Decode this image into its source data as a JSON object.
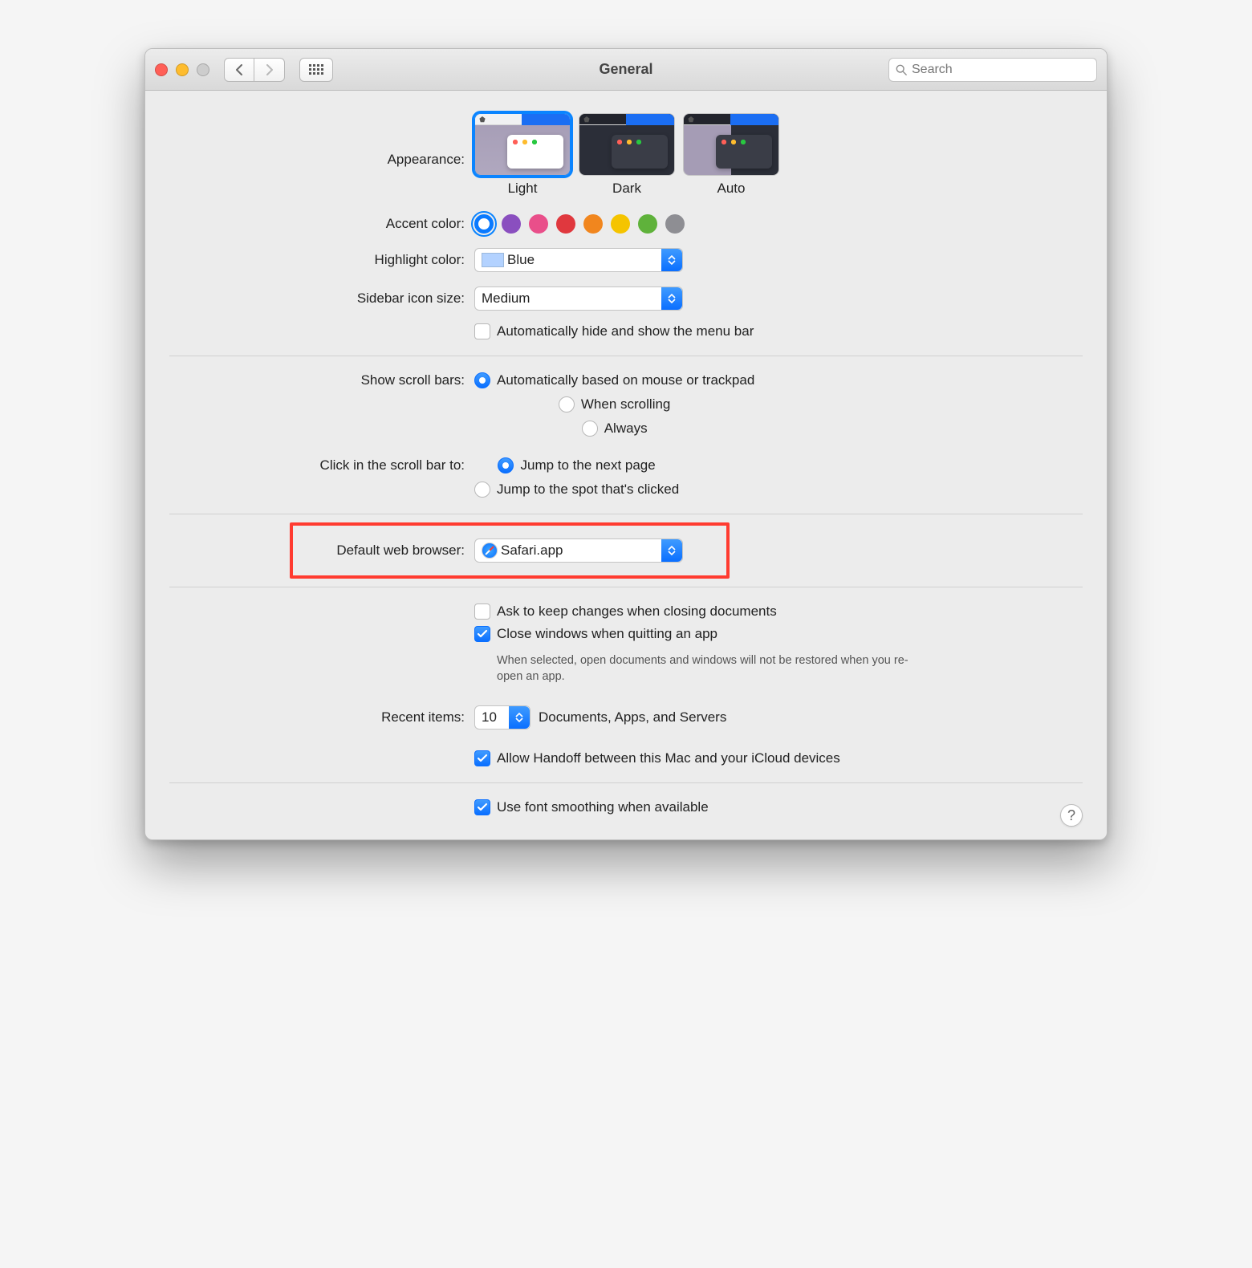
{
  "window": {
    "title": "General"
  },
  "toolbar": {
    "search_placeholder": "Search"
  },
  "appearance": {
    "label": "Appearance:",
    "options": [
      "Light",
      "Dark",
      "Auto"
    ],
    "selected": "Light"
  },
  "accent": {
    "label": "Accent color:",
    "colors": [
      "#0a7aff",
      "#8a4fbf",
      "#e94f8a",
      "#e0383e",
      "#f1861e",
      "#f5c400",
      "#5fb23b",
      "#8e8e93"
    ],
    "selected_index": 0
  },
  "highlight": {
    "label": "Highlight color:",
    "value": "Blue"
  },
  "sidebar": {
    "label": "Sidebar icon size:",
    "value": "Medium"
  },
  "menubar_autohide": {
    "label": "Automatically hide and show the menu bar",
    "checked": false
  },
  "scrollbars": {
    "label": "Show scroll bars:",
    "options": [
      "Automatically based on mouse or trackpad",
      "When scrolling",
      "Always"
    ],
    "selected_index": 0
  },
  "click_scrollbar": {
    "label": "Click in the scroll bar to:",
    "options": [
      "Jump to the next page",
      "Jump to the spot that's clicked"
    ],
    "selected_index": 0
  },
  "default_browser": {
    "label": "Default web browser:",
    "value": "Safari.app"
  },
  "ask_keep": {
    "label": "Ask to keep changes when closing documents",
    "checked": false
  },
  "close_windows": {
    "label": "Close windows when quitting an app",
    "checked": true,
    "note": "When selected, open documents and windows will not be restored when you re-open an app."
  },
  "recent": {
    "label": "Recent items:",
    "value": "10",
    "suffix": "Documents, Apps, and Servers"
  },
  "handoff": {
    "label": "Allow Handoff between this Mac and your iCloud devices",
    "checked": true
  },
  "font_smoothing": {
    "label": "Use font smoothing when available",
    "checked": true
  },
  "help_tooltip": "?"
}
